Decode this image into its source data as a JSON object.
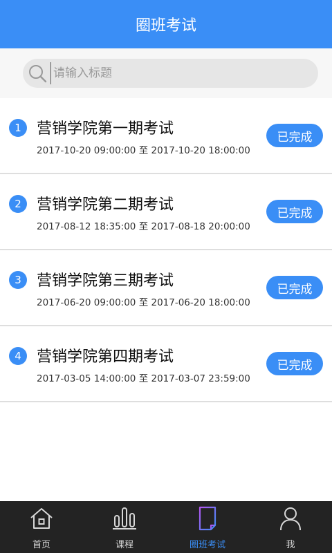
{
  "header": {
    "title": "圈班考试"
  },
  "search": {
    "placeholder": "请输入标题",
    "value": ""
  },
  "exams": [
    {
      "num": "1",
      "title": "营销学院第一期考试",
      "start": "2017-10-20 09:00:00",
      "sep": "至",
      "end": "2017-10-20 18:00:00",
      "status": "已完成"
    },
    {
      "num": "2",
      "title": "营销学院第二期考试",
      "start": "2017-08-12 18:35:00",
      "sep": "至",
      "end": "2017-08-18 20:00:00",
      "status": "已完成"
    },
    {
      "num": "3",
      "title": "营销学院第三期考试",
      "start": "2017-06-20 09:00:00",
      "sep": "至",
      "end": "2017-06-20 18:00:00",
      "status": "已完成"
    },
    {
      "num": "4",
      "title": "营销学院第四期考试",
      "start": "2017-03-05 14:00:00",
      "sep": "至",
      "end": "2017-03-07 23:59:00",
      "status": "已完成"
    }
  ],
  "tabbar": {
    "items": [
      {
        "label": "首页",
        "icon": "home-icon"
      },
      {
        "label": "课程",
        "icon": "bar-chart-icon"
      },
      {
        "label": "圈班考试",
        "icon": "exam-document-icon",
        "active": true
      },
      {
        "label": "我",
        "icon": "person-icon"
      }
    ]
  },
  "colors": {
    "accent": "#3a8ef6",
    "tabbar_bg": "#232323",
    "search_bg": "#e6e6e6"
  }
}
